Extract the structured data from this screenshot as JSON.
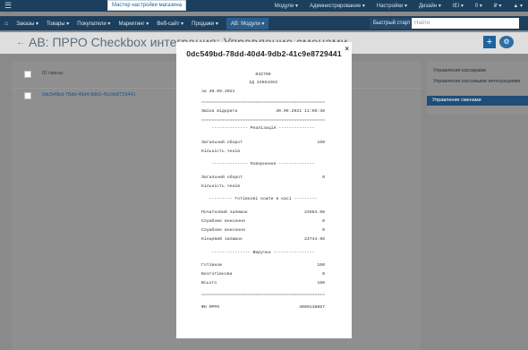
{
  "topbar": {
    "master": "Мастер настройки магазина",
    "items": [
      "Модули ▾",
      "Администрирование ▾",
      "Настройки ▾",
      "Дизайн ▾",
      "IEI ▾",
      "0 ▾",
      "₽ ▾",
      "▲ ▾"
    ]
  },
  "nav": {
    "items": [
      "Заказы ▾",
      "Товары ▾",
      "Покупатели ▾",
      "Маркетинг ▾",
      "Веб-сайт ▾",
      "Продажи ▾"
    ],
    "active": "АВ: Модули ▾",
    "quick_start": "Быстрый старт ▾",
    "search_placeholder": "Найти"
  },
  "page": {
    "title": "АВ: ПРРО Checkbox интеграция: Управление сменами"
  },
  "table": {
    "header": "ID смены",
    "rows": [
      "0dc549bd-78dd-40d4-9db2-41c9e8729441"
    ]
  },
  "sidebar": {
    "items": [
      "Управление кассирами",
      "Управление кассовыми интеграциями"
    ],
    "active": "Управление сменами"
  },
  "modal": {
    "title": "0dc549bd-78dd-40d4-9db2-41c9e8729441",
    "receipt": {
      "code": "042709",
      "id_line": "ІД 34554363",
      "date_line": "за 30.09.2021",
      "sep": "================================================",
      "opened_label": "Зміна відкрита",
      "opened_value": "30.09.2021 11:06:38",
      "sales_header": "-------------- Реалізація --------------",
      "sales_turnover_label": "Загальний оборот",
      "sales_turnover_value": "160",
      "sales_checks_label": "Кількість чеків",
      "sales_checks_value": "",
      "returns_header": "-------------- Повернення --------------",
      "returns_turnover_label": "Загальний оборот",
      "returns_turnover_value": "0",
      "returns_checks_label": "Кількість чеків",
      "returns_checks_value": "",
      "cash_header": "--------- Готівкові кошти в касі ---------",
      "cash_initial_label": "Початковий залишок",
      "cash_initial_value": "24584.98",
      "cash_service1_label": "Службове внесення",
      "cash_service1_value": "0",
      "cash_service2_label": "Службове внесення",
      "cash_service2_value": "0",
      "cash_final_label": "Кінцевий залишок",
      "cash_final_value": "24744.98",
      "revenue_header": "--------------- Виручка ----------------",
      "rev_cash_label": "Готівкою",
      "rev_cash_value": "160",
      "rev_noncash_label": "Безготівкова",
      "rev_noncash_value": "0",
      "rev_total_label": "Всього",
      "rev_total_value": "160",
      "fn_label": "ФН ПРРО",
      "fn_value": "4000138067"
    }
  }
}
